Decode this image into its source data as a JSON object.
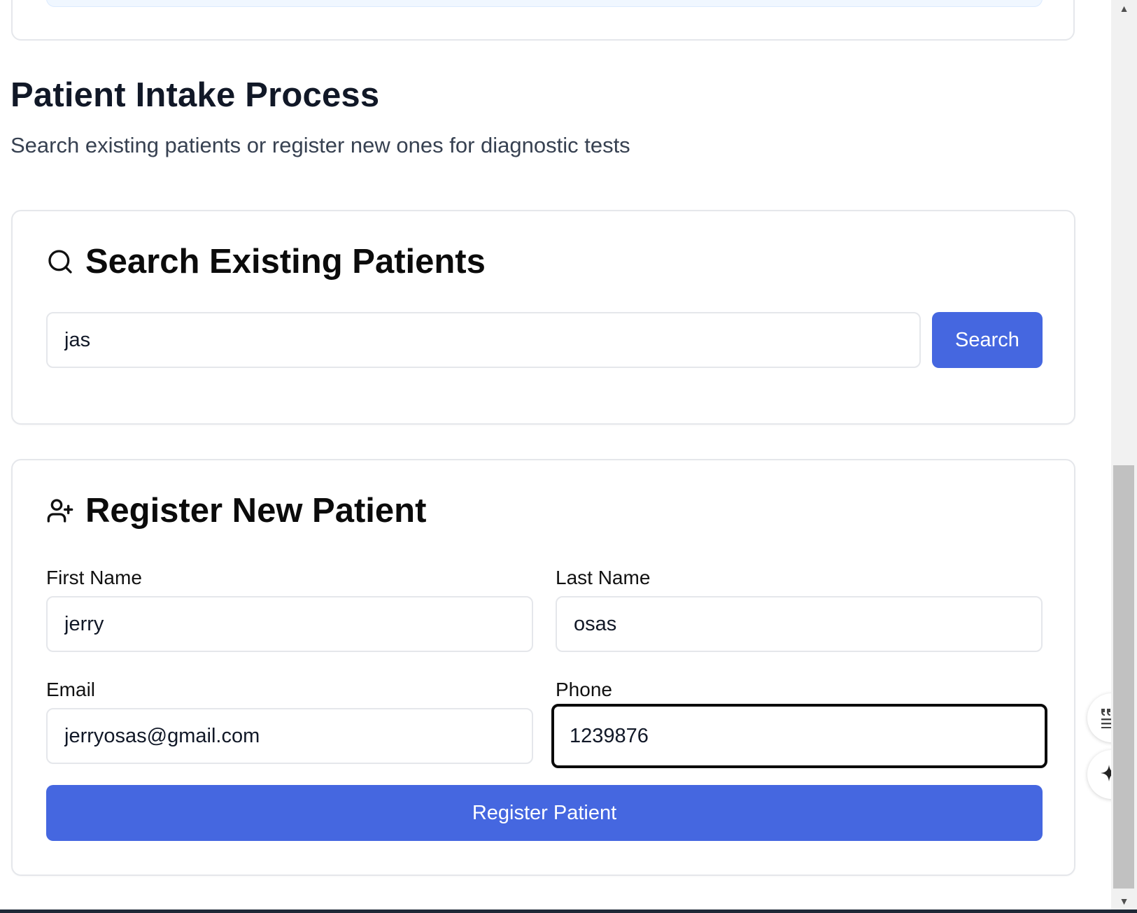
{
  "page": {
    "title": "Patient Intake Process",
    "subtitle": "Search existing patients or register new ones for diagnostic tests"
  },
  "search_card": {
    "icon": "search-icon",
    "title": "Search Existing Patients",
    "query_value": "jas",
    "button_label": "Search"
  },
  "register_card": {
    "icon": "user-plus-icon",
    "title": "Register New Patient",
    "fields": {
      "first_name": {
        "label": "First Name",
        "value": "jerry"
      },
      "last_name": {
        "label": "Last Name",
        "value": "osas"
      },
      "email": {
        "label": "Email",
        "value": "jerryosas@gmail.com"
      },
      "phone": {
        "label": "Phone",
        "value": "1239876"
      }
    },
    "button_label": "Register Patient"
  },
  "side_tools": {
    "reader_icon": "reading-mode-icon",
    "ai_icon": "sparkle-icon"
  },
  "colors": {
    "primary": "#4567e0",
    "heading": "#111827",
    "muted": "#374151",
    "border": "#e5e7eb",
    "focus_border": "#0a0a0a"
  }
}
